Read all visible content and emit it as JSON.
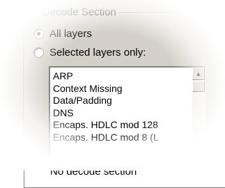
{
  "group": {
    "title": "Decode Section"
  },
  "radios": [
    {
      "label": "All layers",
      "selected": true
    },
    {
      "label": "Selected layers only:",
      "selected": false
    }
  ],
  "list": {
    "items": [
      "ARP",
      "Context Missing",
      "Data/Padding",
      "DNS",
      "Encaps. HDLC mod 128",
      "Encaps. HDLC mod 8 (L"
    ]
  },
  "bottom_option": {
    "label": "No decode section"
  }
}
